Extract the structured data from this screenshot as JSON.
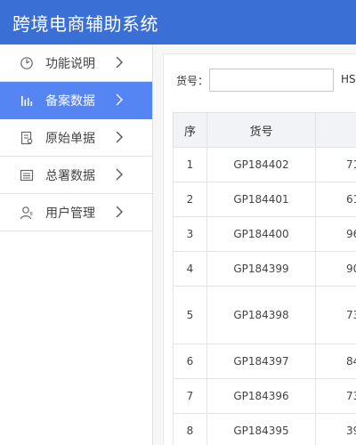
{
  "header": {
    "title": "跨境电商辅助系统"
  },
  "sidebar": {
    "items": [
      {
        "label": "功能说明",
        "icon": "compass-icon",
        "active": false
      },
      {
        "label": "备案数据",
        "icon": "bar-chart-icon",
        "active": true
      },
      {
        "label": "原始单据",
        "icon": "document-icon",
        "active": false
      },
      {
        "label": "总署数据",
        "icon": "list-icon",
        "active": false
      },
      {
        "label": "用户管理",
        "icon": "user-icon",
        "active": false
      }
    ]
  },
  "search": {
    "goods_no_label": "货号：",
    "goods_no_value": "",
    "hs_label": "HS"
  },
  "table": {
    "headers": [
      "序",
      "货号",
      ""
    ],
    "rows": [
      {
        "seq": "1",
        "goods_no": "GP184402",
        "hs": "71"
      },
      {
        "seq": "2",
        "goods_no": "GP184401",
        "hs": "61"
      },
      {
        "seq": "3",
        "goods_no": "GP184400",
        "hs": "96"
      },
      {
        "seq": "4",
        "goods_no": "GP184399",
        "hs": "90"
      },
      {
        "seq": "5",
        "goods_no": "GP184398",
        "hs": "73"
      },
      {
        "seq": "6",
        "goods_no": "GP184397",
        "hs": "84"
      },
      {
        "seq": "7",
        "goods_no": "GP184396",
        "hs": "73"
      },
      {
        "seq": "8",
        "goods_no": "GP184395",
        "hs": "39"
      }
    ]
  },
  "colors": {
    "header_bg": "#3a6fd6",
    "active_item_bg": "#5585f2",
    "table_header_bg": "#f1f3f6"
  }
}
